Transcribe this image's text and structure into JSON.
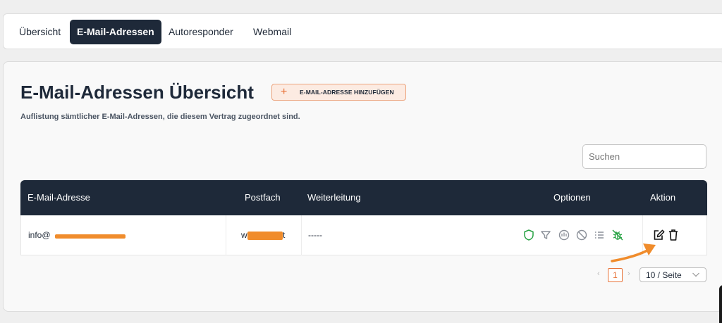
{
  "tabs": [
    {
      "label": "Übersicht",
      "active": false
    },
    {
      "label": "E-Mail-Adressen",
      "active": true
    },
    {
      "label": "Autoresponder",
      "active": false
    },
    {
      "label": "Webmail",
      "active": false
    }
  ],
  "header": {
    "title": "E-Mail-Adressen Übersicht",
    "add_button_label": "E-MAIL-ADRESSE HINZUFÜGEN",
    "subtitle": "Auflistung sämtlicher E-Mail-Adressen, die diesem Vertrag zugeordnet sind."
  },
  "search": {
    "placeholder": "Suchen"
  },
  "table": {
    "columns": [
      "E-Mail-Adresse",
      "Postfach",
      "Weiterleitung",
      "Optionen",
      "Aktion"
    ],
    "rows": [
      {
        "email_prefix": "info@",
        "postfach_visible": "w",
        "postfach_suffix": "t",
        "weiterleitung": "-----"
      }
    ]
  },
  "option_icons": [
    "shield-icon",
    "filter-icon",
    "gauge-icon",
    "block-icon",
    "list-icon",
    "bug-icon"
  ],
  "action_icons": [
    "edit-icon",
    "trash-icon"
  ],
  "pagination": {
    "prev": "‹",
    "current_page": "1",
    "next": "›",
    "per_page": "10 / Seite"
  },
  "colors": {
    "accent": "#e8743a",
    "dark": "#1e2939",
    "shield_green": "#27a243",
    "redaction": "#f08c2c",
    "icon_gray": "#8a8f98"
  }
}
